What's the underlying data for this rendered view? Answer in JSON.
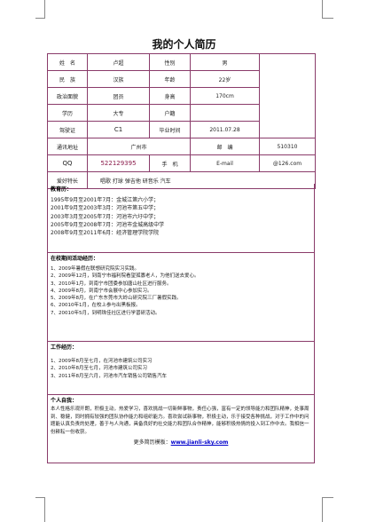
{
  "title": "我的个人简历",
  "info": {
    "name_label": "姓　名",
    "name": "卢超",
    "gender_label": "性别",
    "gender": "男",
    "ethnicity_label": "民　族",
    "ethnicity": "汉族",
    "age_label": "年龄",
    "age": "22岁",
    "politics_label": "政治面貌",
    "politics": "团员",
    "height_label": "身高",
    "height": "170cm",
    "education_label": "学历",
    "education": "大专",
    "hukou_label": "户籍",
    "hukou": "",
    "license_label": "驾驶证",
    "license": "C1",
    "grad_label": "毕业时间",
    "grad": "2011.07.28",
    "address_label": "通讯地址",
    "address": "广州市",
    "postcode_label": "邮　编",
    "postcode": "510310",
    "qq_label": "QQ",
    "qq": "522129395",
    "phone_label": "手　机",
    "phone": "",
    "email_label": "E-mail",
    "email": "@126.com",
    "hobby_label": "爱好特长",
    "hobby": "唱歌 打球 弹吉他 研音乐 汽车"
  },
  "education": {
    "title": "教育历：",
    "items": [
      "1995年9月至2001年7月：金城江第六小学；",
      "2001年9月至2003年3月：河池市第五中学；",
      "2003年3月至2005年7月：河池市六圩中学；",
      "2005年9月至2008年7月：河池市金城高级中学",
      "2008年9月至2011年6月：经济管理学院学院"
    ]
  },
  "practice": {
    "title": "在校期间活动经历：",
    "items": [
      "1、2009年暑假在联想研究院实习实践。",
      "2、2009年12月，到南宁市福利院看望孤寡老人，为他们送去爱心。",
      "3、2010年1月，到南宁市团委参加唐山社区进行服务。",
      "4、2009年8月，到南宁市会展中心参加实习。",
      "5、2009年8月，在广东东莞市大岭山研究院三厂暑假实践。",
      "6、20010年1月，在校上参与出黑板报。",
      "7、20010年5月，到明珠佳社区进行学習研活动。"
    ]
  },
  "work": {
    "title": "工作经历：",
    "items": [
      "1、2009年8月至七月，在河池市建筑公司实习",
      "2、2010年8月至七月，河池市建筑公司实习",
      "3、2011年8月至六月，河池市汽车销售公司销售汽车"
    ]
  },
  "self": {
    "title": "个人自我：",
    "text": "本人性格乐观开朗，积极主动，热爱学习，喜欢挑战一切新鲜事物，责任心强，富有一定的领导能力和团队精神，处事周到、稳健，同时拥有较强的团队协作能力和组织能力。喜欢尝试新事物，积极主动，乐于接受各种挑战，对于工作中的问题能认真负责的处理，善于与人沟通，具备良好的社交能力和团队合作精神，能够积极热情的投入到工作中去。我相信一份耕耘一份收获。",
    "more_label": "更多简历模板：",
    "more_link": "www.jianli-sky.com"
  }
}
